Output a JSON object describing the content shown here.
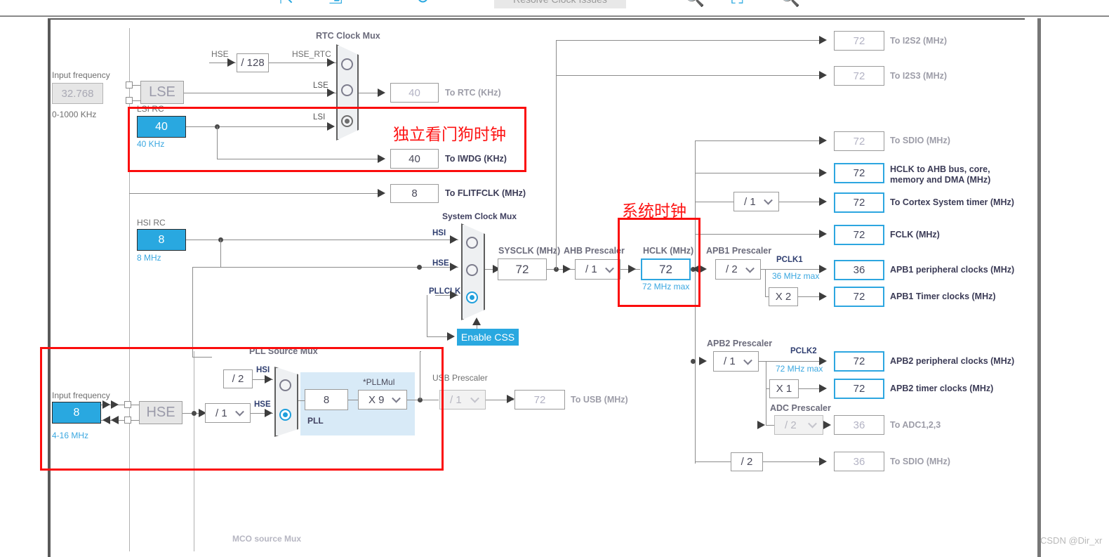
{
  "toolbar": {
    "resolve_button": "Resolve Clock Issues",
    "icons": [
      "undo-icon",
      "redo-icon",
      "reset-icon",
      "zoom-out-icon",
      "fit-icon",
      "zoom-in-icon"
    ]
  },
  "watermark": "CSDN @Dir_xr",
  "annotations": {
    "iwdg_note": "独立看门狗时钟",
    "sysclk_note": "系统时钟",
    "color": "#fd1414"
  },
  "lse": {
    "input_frequency_label": "Input frequency",
    "value": "32.768",
    "range": "0-1000 KHz",
    "name": "LSE"
  },
  "lsi": {
    "title": "LSI RC",
    "value": "40",
    "unit": "40 KHz"
  },
  "hsi": {
    "title": "HSI RC",
    "value": "8",
    "unit": "8 MHz"
  },
  "hse": {
    "input_frequency_label": "Input frequency",
    "value": "8",
    "range": "4-16 MHz",
    "name": "HSE"
  },
  "rtc_mux": {
    "title": "RTC Clock Mux",
    "hse_divider": "/ 128",
    "inputs": [
      "HSE_RTC",
      "LSE",
      "LSI"
    ],
    "selected_index": 2,
    "hse_in_label": "HSE"
  },
  "system_clock_mux": {
    "title": "System Clock Mux",
    "inputs": [
      "HSI",
      "HSE",
      "PLLCLK"
    ],
    "selected_index": 2,
    "css_button": "Enable CSS"
  },
  "pll_source_mux": {
    "title": "PLL Source Mux",
    "hsi_divider": "/ 2",
    "hse_divider": "/ 1",
    "inputs": [
      "HSI",
      "HSE"
    ],
    "selected_index": 1,
    "pll_label": "PLL",
    "pll_input_value": "8",
    "pllmul_label": "*PLLMul",
    "pllmul_value": "X 9"
  },
  "mco_source_mux_label": "MCO source Mux",
  "prescalers": {
    "ahb": {
      "label": "AHB Prescaler",
      "value": "/ 1"
    },
    "apb1": {
      "label": "APB1 Prescaler",
      "value": "/ 2",
      "pclk": "PCLK1",
      "max": "36 MHz max",
      "timer_mul": "X 2"
    },
    "apb2": {
      "label": "APB2 Prescaler",
      "value": "/ 1",
      "pclk": "PCLK2",
      "max": "72 MHz max",
      "timer_mul": "X 1"
    },
    "adc": {
      "label": "ADC Prescaler",
      "value": "/ 2"
    },
    "usb": {
      "label": "USB Prescaler",
      "value": "/ 1"
    },
    "cortex": {
      "value": "/ 1"
    },
    "sdio": {
      "value": "/ 2"
    }
  },
  "sysclk": {
    "label": "SYSCLK (MHz)",
    "value": "72"
  },
  "hclk": {
    "label": "HCLK (MHz)",
    "value": "72",
    "max": "72 MHz max"
  },
  "outputs": {
    "rtc": {
      "value": "40",
      "label": "To RTC (KHz)",
      "state": "dim"
    },
    "iwdg": {
      "value": "40",
      "label": "To IWDG (KHz)",
      "state": "plain"
    },
    "flitf": {
      "value": "8",
      "label": "To FLITFCLK (MHz)",
      "state": "plain"
    },
    "usb": {
      "value": "72",
      "label": "To USB (MHz)",
      "state": "dim"
    },
    "i2s2": {
      "value": "72",
      "label": "To I2S2 (MHz)",
      "state": "dim"
    },
    "i2s3": {
      "value": "72",
      "label": "To I2S3 (MHz)",
      "state": "dim"
    },
    "sdio_top": {
      "value": "72",
      "label": "To SDIO (MHz)",
      "state": "dim"
    },
    "hclk_ahb": {
      "value": "72",
      "label": "HCLK to AHB bus, core,",
      "label2": "memory and DMA (MHz)",
      "state": "active"
    },
    "cortex": {
      "value": "72",
      "label": "To Cortex System timer (MHz)",
      "state": "active"
    },
    "fclk": {
      "value": "72",
      "label": "FCLK (MHz)",
      "state": "active"
    },
    "apb1_periph": {
      "value": "36",
      "label": "APB1 peripheral clocks (MHz)",
      "state": "active"
    },
    "apb1_timer": {
      "value": "72",
      "label": "APB1 Timer clocks (MHz)",
      "state": "active"
    },
    "apb2_periph": {
      "value": "72",
      "label": "APB2 peripheral clocks (MHz)",
      "state": "active"
    },
    "apb2_timer": {
      "value": "72",
      "label": "APB2 timer clocks (MHz)",
      "state": "active"
    },
    "adc": {
      "value": "36",
      "label": "To ADC1,2,3",
      "state": "dim"
    },
    "sdio_bot": {
      "value": "36",
      "label": "To SDIO (MHz)",
      "state": "dim"
    }
  }
}
